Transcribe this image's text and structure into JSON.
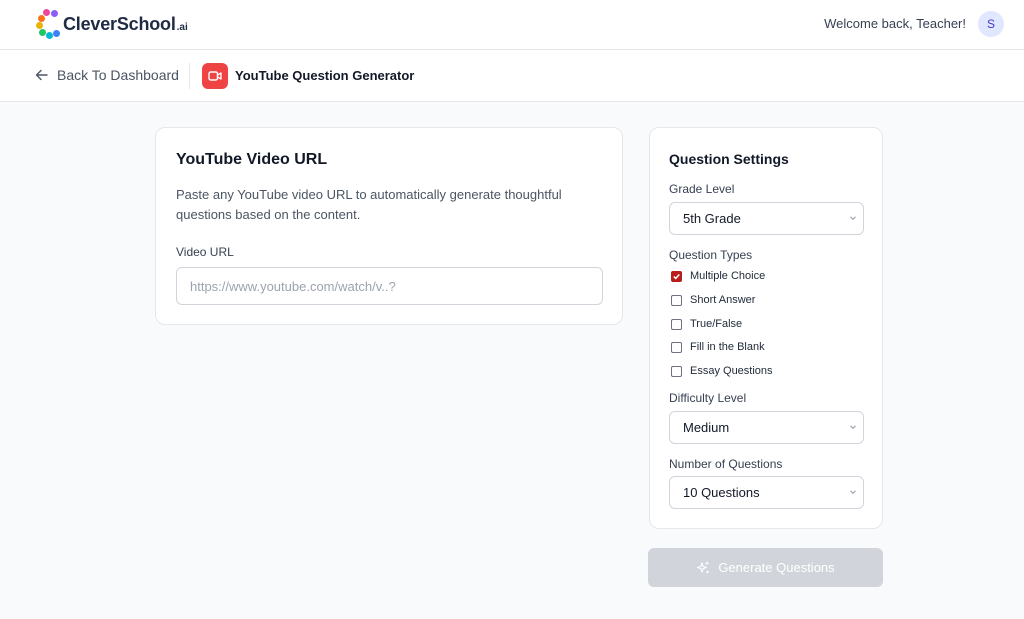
{
  "header": {
    "logo_text": "CleverSchool",
    "logo_suffix": ".ai",
    "welcome": "Welcome back, Teacher!",
    "avatar_initial": "S"
  },
  "subheader": {
    "back_label": "Back To Dashboard",
    "tool_title": "YouTube Question Generator",
    "tool_icon": "video-camera-icon"
  },
  "url_card": {
    "title": "YouTube Video URL",
    "description": "Paste any YouTube video URL to automatically generate thoughtful questions based on the content.",
    "field_label": "Video URL",
    "field_placeholder": "https://www.youtube.com/watch/v..?",
    "field_value": ""
  },
  "settings": {
    "title": "Question Settings",
    "grade": {
      "label": "Grade Level",
      "value": "5th Grade"
    },
    "types": {
      "label": "Question Types",
      "options": [
        {
          "label": "Multiple Choice",
          "checked": true
        },
        {
          "label": "Short Answer",
          "checked": false
        },
        {
          "label": "True/False",
          "checked": false
        },
        {
          "label": "Fill in the Blank",
          "checked": false
        },
        {
          "label": "Essay Questions",
          "checked": false
        }
      ]
    },
    "difficulty": {
      "label": "Difficulty Level",
      "value": "Medium"
    },
    "count": {
      "label": "Number of Questions",
      "value": "10 Questions"
    }
  },
  "generate_button": {
    "label": "Generate Questions",
    "enabled": false
  },
  "colors": {
    "accent_red": "#ef4444",
    "checkbox_checked": "#b91c1c",
    "button_disabled": "#d1d5db"
  }
}
